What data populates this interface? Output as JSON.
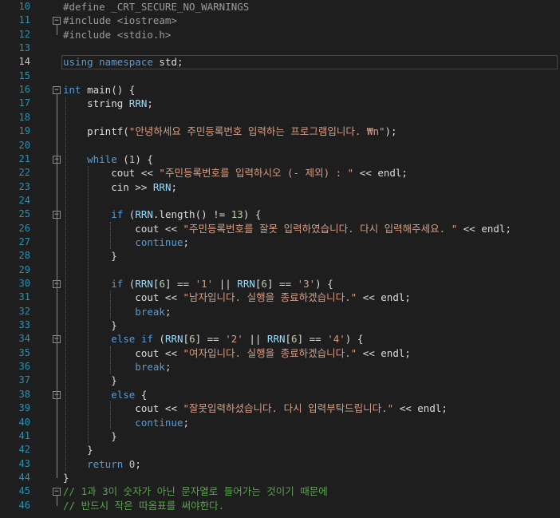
{
  "editor": {
    "lines": [
      {
        "n": "10",
        "tokens": [
          {
            "t": "#define _CRT_SECURE_NO_WARNINGS",
            "c": "pp"
          }
        ]
      },
      {
        "n": "11",
        "tokens": [
          {
            "t": "#include <iostream>",
            "c": "pp"
          }
        ]
      },
      {
        "n": "12",
        "tokens": [
          {
            "t": "#include <stdio.h>",
            "c": "pp"
          }
        ]
      },
      {
        "n": "13",
        "tokens": []
      },
      {
        "n": "14",
        "tokens": [
          {
            "t": "using namespace ",
            "c": "kw"
          },
          {
            "t": "std;",
            "c": "txt"
          }
        ]
      },
      {
        "n": "15",
        "tokens": []
      },
      {
        "n": "16",
        "tokens": [
          {
            "t": "int ",
            "c": "kw"
          },
          {
            "t": "main() {",
            "c": "txt"
          }
        ]
      },
      {
        "n": "17",
        "tokens": [
          {
            "t": "    string ",
            "c": "txt"
          },
          {
            "t": "RRN",
            "c": "var"
          },
          {
            "t": ";",
            "c": "txt"
          }
        ]
      },
      {
        "n": "18",
        "tokens": []
      },
      {
        "n": "19",
        "tokens": [
          {
            "t": "    printf(",
            "c": "txt"
          },
          {
            "t": "\"안녕하세요 주민등록번호 입력하는 프로그램입니다. ₩n\"",
            "c": "str"
          },
          {
            "t": ");",
            "c": "txt"
          }
        ]
      },
      {
        "n": "20",
        "tokens": []
      },
      {
        "n": "21",
        "tokens": [
          {
            "t": "    while ",
            "c": "kw"
          },
          {
            "t": "(",
            "c": "txt"
          },
          {
            "t": "1",
            "c": "num"
          },
          {
            "t": ") {",
            "c": "txt"
          }
        ]
      },
      {
        "n": "22",
        "tokens": [
          {
            "t": "        cout << ",
            "c": "txt"
          },
          {
            "t": "\"주민등록번호를 입력하시오 (- 제외) : \"",
            "c": "str"
          },
          {
            "t": " << endl;",
            "c": "txt"
          }
        ]
      },
      {
        "n": "23",
        "tokens": [
          {
            "t": "        cin >> ",
            "c": "txt"
          },
          {
            "t": "RRN",
            "c": "var"
          },
          {
            "t": ";",
            "c": "txt"
          }
        ]
      },
      {
        "n": "24",
        "tokens": []
      },
      {
        "n": "25",
        "tokens": [
          {
            "t": "        if ",
            "c": "kw"
          },
          {
            "t": "(",
            "c": "txt"
          },
          {
            "t": "RRN",
            "c": "var"
          },
          {
            "t": ".length() != ",
            "c": "txt"
          },
          {
            "t": "13",
            "c": "num"
          },
          {
            "t": ") {",
            "c": "txt"
          }
        ]
      },
      {
        "n": "26",
        "tokens": [
          {
            "t": "            cout << ",
            "c": "txt"
          },
          {
            "t": "\"주민등록번호를 잘못 입력하였습니다. 다시 입력해주세요. \"",
            "c": "str"
          },
          {
            "t": " << endl;",
            "c": "txt"
          }
        ]
      },
      {
        "n": "27",
        "tokens": [
          {
            "t": "            continue",
            "c": "kw"
          },
          {
            "t": ";",
            "c": "txt"
          }
        ]
      },
      {
        "n": "28",
        "tokens": [
          {
            "t": "        }",
            "c": "txt"
          }
        ]
      },
      {
        "n": "29",
        "tokens": []
      },
      {
        "n": "30",
        "tokens": [
          {
            "t": "        if ",
            "c": "kw"
          },
          {
            "t": "(",
            "c": "txt"
          },
          {
            "t": "RRN",
            "c": "var"
          },
          {
            "t": "[",
            "c": "txt"
          },
          {
            "t": "6",
            "c": "num"
          },
          {
            "t": "] == ",
            "c": "txt"
          },
          {
            "t": "'1'",
            "c": "str"
          },
          {
            "t": " || ",
            "c": "txt"
          },
          {
            "t": "RRN",
            "c": "var"
          },
          {
            "t": "[",
            "c": "txt"
          },
          {
            "t": "6",
            "c": "num"
          },
          {
            "t": "] == ",
            "c": "txt"
          },
          {
            "t": "'3'",
            "c": "str"
          },
          {
            "t": ") {",
            "c": "txt"
          }
        ]
      },
      {
        "n": "31",
        "tokens": [
          {
            "t": "            cout << ",
            "c": "txt"
          },
          {
            "t": "\"남자입니다. 실행을 종료하겠습니다.\"",
            "c": "str"
          },
          {
            "t": " << endl;",
            "c": "txt"
          }
        ]
      },
      {
        "n": "32",
        "tokens": [
          {
            "t": "            break",
            "c": "kw"
          },
          {
            "t": ";",
            "c": "txt"
          }
        ]
      },
      {
        "n": "33",
        "tokens": [
          {
            "t": "        }",
            "c": "txt"
          }
        ]
      },
      {
        "n": "34",
        "tokens": [
          {
            "t": "        else if ",
            "c": "kw"
          },
          {
            "t": "(",
            "c": "txt"
          },
          {
            "t": "RRN",
            "c": "var"
          },
          {
            "t": "[",
            "c": "txt"
          },
          {
            "t": "6",
            "c": "num"
          },
          {
            "t": "] == ",
            "c": "txt"
          },
          {
            "t": "'2'",
            "c": "str"
          },
          {
            "t": " || ",
            "c": "txt"
          },
          {
            "t": "RRN",
            "c": "var"
          },
          {
            "t": "[",
            "c": "txt"
          },
          {
            "t": "6",
            "c": "num"
          },
          {
            "t": "] == ",
            "c": "txt"
          },
          {
            "t": "'4'",
            "c": "str"
          },
          {
            "t": ") {",
            "c": "txt"
          }
        ]
      },
      {
        "n": "35",
        "tokens": [
          {
            "t": "            cout << ",
            "c": "txt"
          },
          {
            "t": "\"여자입니다. 실행을 종료하겠습니다.\"",
            "c": "str"
          },
          {
            "t": " << endl;",
            "c": "txt"
          }
        ]
      },
      {
        "n": "36",
        "tokens": [
          {
            "t": "            break",
            "c": "kw"
          },
          {
            "t": ";",
            "c": "txt"
          }
        ]
      },
      {
        "n": "37",
        "tokens": [
          {
            "t": "        }",
            "c": "txt"
          }
        ]
      },
      {
        "n": "38",
        "tokens": [
          {
            "t": "        else ",
            "c": "kw"
          },
          {
            "t": "{",
            "c": "txt"
          }
        ]
      },
      {
        "n": "39",
        "tokens": [
          {
            "t": "            cout << ",
            "c": "txt"
          },
          {
            "t": "\"잘못입력하셨습니다. 다시 입력부탁드립니다.\"",
            "c": "str"
          },
          {
            "t": " << endl;",
            "c": "txt"
          }
        ]
      },
      {
        "n": "40",
        "tokens": [
          {
            "t": "            continue",
            "c": "kw"
          },
          {
            "t": ";",
            "c": "txt"
          }
        ]
      },
      {
        "n": "41",
        "tokens": [
          {
            "t": "        }",
            "c": "txt"
          }
        ]
      },
      {
        "n": "42",
        "tokens": [
          {
            "t": "    }",
            "c": "txt"
          }
        ]
      },
      {
        "n": "43",
        "tokens": [
          {
            "t": "    return ",
            "c": "kw"
          },
          {
            "t": "0",
            "c": "num"
          },
          {
            "t": ";",
            "c": "txt"
          }
        ]
      },
      {
        "n": "44",
        "tokens": [
          {
            "t": "}",
            "c": "txt"
          }
        ]
      },
      {
        "n": "45",
        "tokens": [
          {
            "t": "// 1과 3이 숫자가 아닌 문자열로 들어가는 것이기 때문에",
            "c": "cm"
          }
        ]
      },
      {
        "n": "46",
        "tokens": [
          {
            "t": "// 반드시 작은 따옴표를 써야한다.",
            "c": "cm"
          }
        ]
      }
    ],
    "current_line": "14",
    "fold_markers": [
      "11",
      "16",
      "21",
      "25",
      "30",
      "34",
      "38",
      "45"
    ],
    "fold_symbol": "−"
  }
}
